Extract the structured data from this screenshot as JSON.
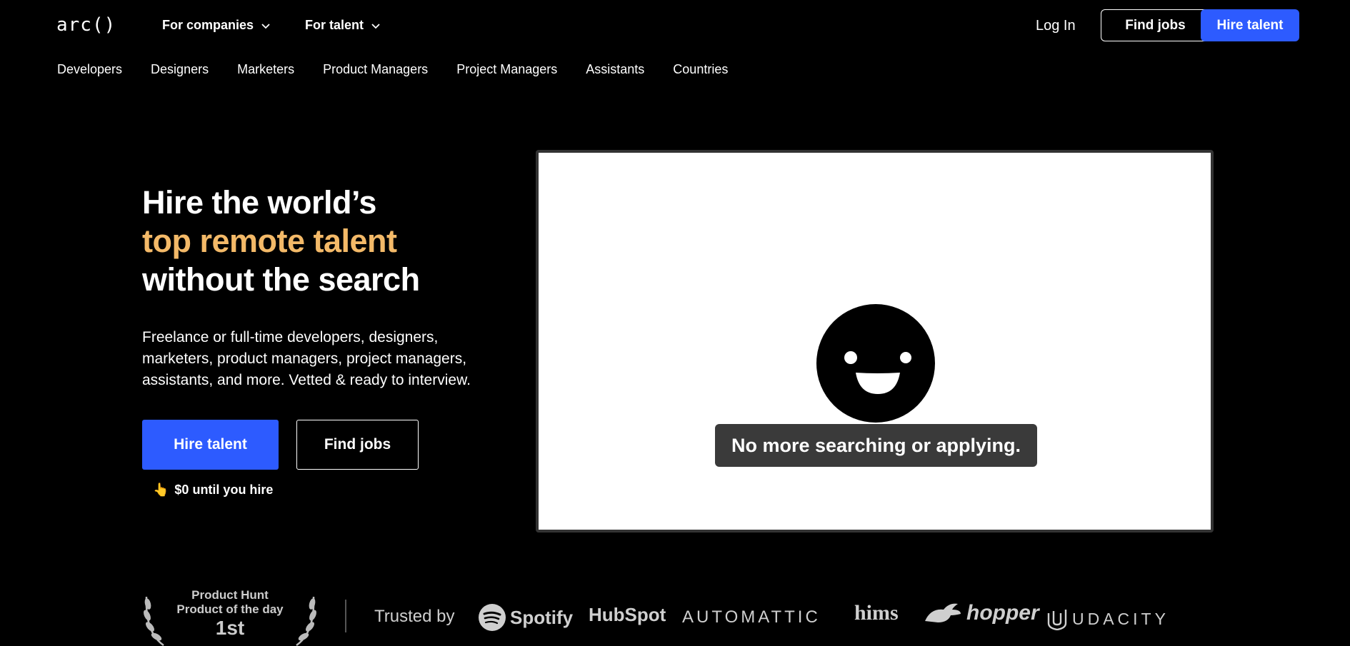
{
  "header": {
    "logo": "arc()",
    "for_companies": "For companies",
    "for_talent": "For talent",
    "log_in": "Log In",
    "find_jobs": "Find jobs",
    "hire_talent": "Hire talent"
  },
  "subnav": {
    "items": [
      "Developers",
      "Designers",
      "Marketers",
      "Product Managers",
      "Project Managers",
      "Assistants",
      "Countries"
    ]
  },
  "hero": {
    "title_line1": "Hire the world’s",
    "title_line2": "top remote talent",
    "title_line3": "without the search",
    "description": "Freelance or full-time developers, designers, marketers, product managers, project managers, assistants, and more. Vetted & ready to interview.",
    "hire_button": "Hire talent",
    "find_button": "Find jobs",
    "zero_note_icon": "👆",
    "zero_note": "$0 until you hire"
  },
  "video": {
    "caption": "No more searching or applying."
  },
  "trust": {
    "award_line1": "Product Hunt",
    "award_line2": "Product of the day",
    "award_line3": "1st",
    "trusted_by": "Trusted by",
    "brands": [
      "Spotify",
      "HubSpot",
      "AUTOMATTIC",
      "hims",
      "hopper",
      "UDACITY"
    ]
  },
  "colors": {
    "accent_blue": "#2d5bff",
    "highlight_orange": "#f3b968",
    "background": "#000000"
  }
}
